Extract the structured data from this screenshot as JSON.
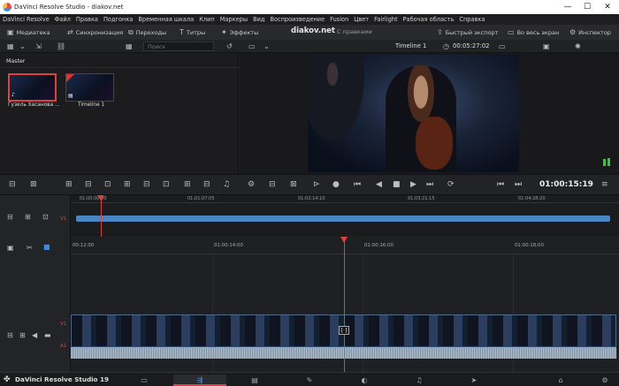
{
  "window": {
    "title": "DaVinci Resolve Studio - diakov.net",
    "minimize": "—",
    "maximize": "☐",
    "close": "✕"
  },
  "menu": [
    "DaVinci Resolve",
    "Файл",
    "Правка",
    "Подгонка",
    "Временная шкала",
    "Клип",
    "Маркеры",
    "Вид",
    "Воспроизведение",
    "Fusion",
    "Цвет",
    "Fairlight",
    "Рабочая область",
    "Справка"
  ],
  "toolbar": {
    "media": "Медиатека",
    "sync": "Синхронизация",
    "transitions": "Переходы",
    "titles": "Титры",
    "effects": "Эффекты",
    "project": "diakov.net",
    "edits": "С правками",
    "quick_export": "Быстрый экспорт",
    "fullscreen": "Во весь экран",
    "inspector": "Инспектор"
  },
  "bar2": {
    "search_placeholder": "Поиск",
    "timeline_name": "Timeline 1",
    "duration": "00:05:27:02"
  },
  "media_pool": {
    "bin": "Master",
    "clips": [
      {
        "label": "Гузель Хасанова ..."
      },
      {
        "label": "Timeline 1"
      }
    ]
  },
  "transport": {
    "timecode": "01:00:15:19"
  },
  "upper_ruler": [
    "01:00:00:00",
    "01:01:07:05",
    "01:02:14:10",
    "01:03:21:15",
    "01:04:28:20"
  ],
  "lower_ruler": [
    "00:12:00",
    "01:00:14:00",
    "01:00:16:00",
    "01:00:18:00"
  ],
  "tracks": {
    "upper_video": "V1",
    "video": "V1",
    "audio": "A1"
  },
  "bottom": {
    "brand": "DaVinci Resolve Studio 19"
  },
  "colors": {
    "accent": "#e04040",
    "clip_blue": "#4b86c4",
    "timeline_active": "#5a8fd6"
  }
}
